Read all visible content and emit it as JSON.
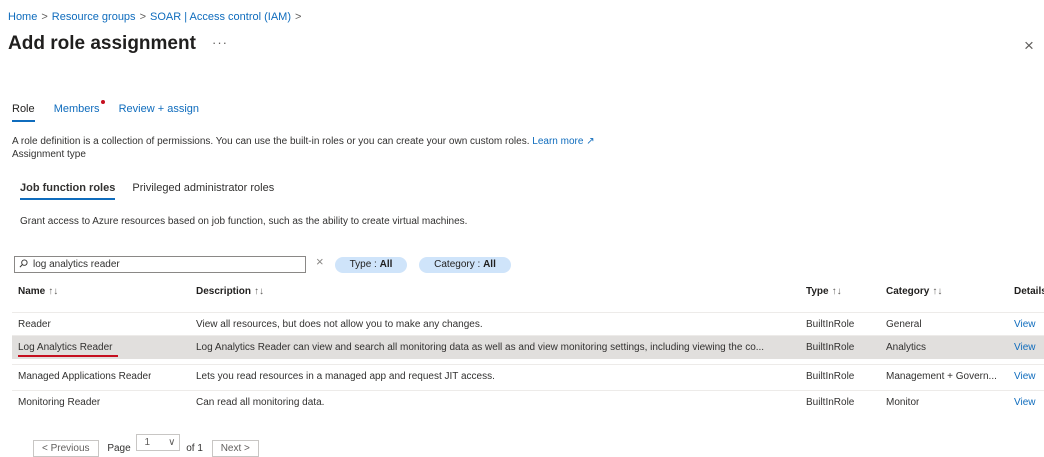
{
  "breadcrumb": {
    "items": [
      "Home",
      "Resource groups",
      "SOAR | Access control (IAM)"
    ],
    "sep": ">"
  },
  "header": {
    "title": "Add role assignment",
    "more": "···",
    "close": "×"
  },
  "tabs": [
    {
      "label": "Role"
    },
    {
      "label": "Members"
    },
    {
      "label": "Review + assign"
    }
  ],
  "role_description": {
    "text": "A role definition is a collection of permissions. You can use the built-in roles or you can create your own custom roles.",
    "learn_more": "Learn more",
    "link_icon": "↗"
  },
  "assignment_type_label": "Assignment type",
  "subtabs": [
    {
      "label": "Job function roles"
    },
    {
      "label": "Privileged administrator roles"
    }
  ],
  "grant_text": "Grant access to Azure resources based on job function, such as the ability to create virtual machines.",
  "search": {
    "value": "log analytics reader",
    "icon": "search-icon",
    "clear": "×"
  },
  "filters": [
    {
      "label": "Type : ",
      "value": "All"
    },
    {
      "label": "Category : ",
      "value": "All"
    }
  ],
  "table": {
    "columns": {
      "name": "Name",
      "description": "Description",
      "type": "Type",
      "category": "Category",
      "details": "Details"
    },
    "sort_glyph_name": "↑↓",
    "sort_glyph": "↑↓",
    "rows": [
      {
        "name": "Reader",
        "description": "View all resources, but does not allow you to make any changes.",
        "type": "BuiltInRole",
        "category": "General",
        "details": "View"
      },
      {
        "name": "Log Analytics Reader",
        "description": "Log Analytics Reader can view and search all monitoring data as well as and view monitoring settings, including viewing the co...",
        "type": "BuiltInRole",
        "category": "Analytics",
        "details": "View"
      },
      {
        "name": "Managed Applications Reader",
        "description": "Lets you read resources in a managed app and request JIT access.",
        "type": "BuiltInRole",
        "category": "Management + Govern...",
        "details": "View"
      },
      {
        "name": "Monitoring Reader",
        "description": "Can read all monitoring data.",
        "type": "BuiltInRole",
        "category": "Monitor",
        "details": "View"
      }
    ]
  },
  "pager": {
    "previous": "< Previous",
    "page_label": "Page",
    "page_value": "1",
    "chevron": "∨",
    "of_label": "of 1",
    "next": "Next >"
  },
  "colors": {
    "accent": "#0f6cbd",
    "selected_row": "#e1dfdd",
    "required_dot": "#c50f1f",
    "filter_pill": "#cfe4fa"
  }
}
